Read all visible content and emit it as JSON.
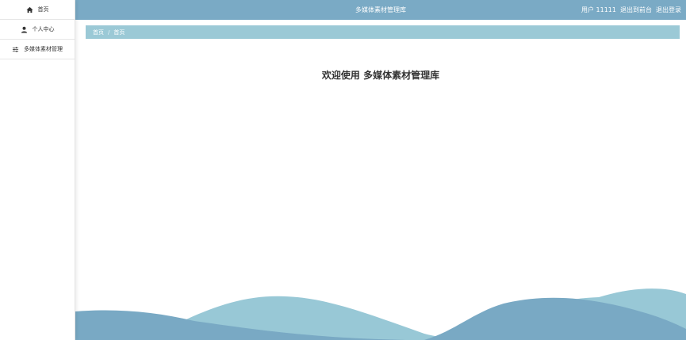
{
  "sidebar": {
    "items": [
      {
        "label": "首页",
        "icon": "home-icon"
      },
      {
        "label": "个人中心",
        "icon": "user-icon"
      },
      {
        "label": "多媒体素材管理",
        "icon": "sliders-icon"
      }
    ]
  },
  "header": {
    "title": "多媒体素材管理库",
    "user_label": "用户 11111",
    "exit_front_label": "退出到前台",
    "logout_label": "退出登录"
  },
  "breadcrumb": {
    "home": "首页",
    "separator": "/",
    "current": "首页"
  },
  "main": {
    "welcome": "欢迎使用 多媒体素材管理库"
  },
  "colors": {
    "topbar": "#7aaac5",
    "breadcrumb": "#9bc9d6",
    "wave_dark": "#79a9c4",
    "wave_light": "#98c8d6"
  }
}
